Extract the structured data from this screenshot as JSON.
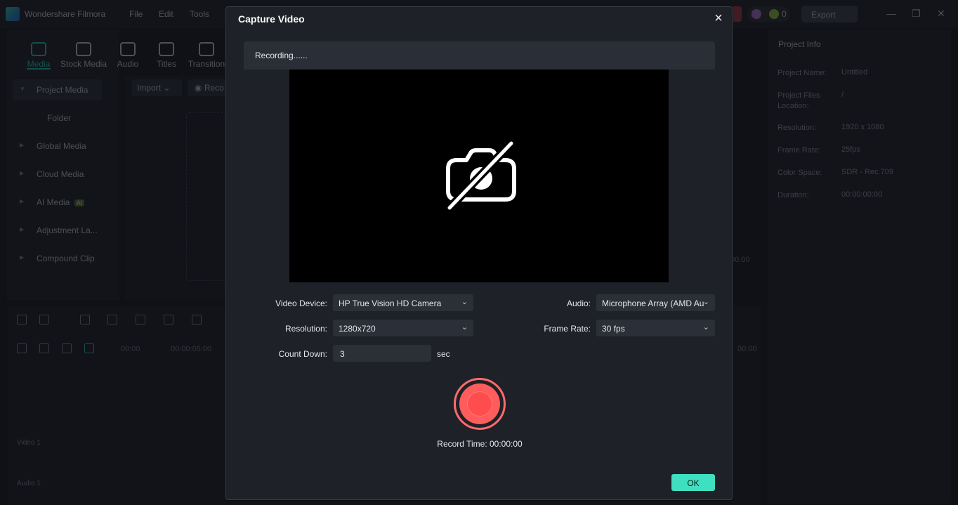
{
  "app": {
    "title": "Wondershare Filmora",
    "menu": [
      "File",
      "Edit",
      "Tools"
    ],
    "credits": "0",
    "export_label": "Export",
    "window_controls": [
      "—",
      "❐",
      "✕"
    ]
  },
  "media_panel": {
    "tools": [
      {
        "label": "Media",
        "icon": "media-icon",
        "active": true
      },
      {
        "label": "Stock Media",
        "icon": "stock-media-icon",
        "active": false
      },
      {
        "label": "Audio",
        "icon": "music-note-icon",
        "active": false
      },
      {
        "label": "Titles",
        "icon": "text-t-icon",
        "active": false
      },
      {
        "label": "Transition",
        "icon": "transition-icon",
        "active": false
      }
    ],
    "sidebar": [
      {
        "label": "Project Media",
        "selected": true
      },
      {
        "label": "Folder",
        "selected": false
      },
      {
        "label": "Global Media",
        "selected": false
      },
      {
        "label": "Cloud Media",
        "selected": false
      },
      {
        "label": "AI Media",
        "badge": "AI",
        "selected": false
      },
      {
        "label": "Adjustment La...",
        "selected": false
      },
      {
        "label": "Compound Clip",
        "selected": false
      }
    ],
    "import_label": "Import",
    "record_label": "Reco"
  },
  "project_info": {
    "title": "Project Info",
    "rows": [
      {
        "label": "Project Name:",
        "value": "Untitled"
      },
      {
        "label": "Project Files Location:",
        "value": "/"
      },
      {
        "label": "Resolution:",
        "value": "1920 x 1080"
      },
      {
        "label": "Frame Rate:",
        "value": "25fps"
      },
      {
        "label": "Color Space:",
        "value": "SDR - Rec.709"
      },
      {
        "label": "Duration:",
        "value": "00:00:00:00"
      }
    ]
  },
  "timeline": {
    "times": [
      "00:00",
      "00:00:05:00",
      "00:00"
    ],
    "preview_time": "00:00",
    "tracks": [
      "Video 1",
      "Audio 1"
    ]
  },
  "dialog": {
    "title": "Capture Video",
    "status": "Recording......",
    "video_device_label": "Video Device:",
    "video_device_value": "HP True Vision HD Camera",
    "audio_label": "Audio:",
    "audio_value": "Microphone Array (AMD Au",
    "resolution_label": "Resolution:",
    "resolution_value": "1280x720",
    "frame_rate_label": "Frame Rate:",
    "frame_rate_value": "30 fps",
    "count_down_label": "Count Down:",
    "count_down_value": "3",
    "count_down_unit": "sec",
    "record_time": "Record Time: 00:00:00",
    "ok_label": "OK",
    "record_color": "#ff5c5c",
    "accent_color": "#3fe0c0"
  }
}
